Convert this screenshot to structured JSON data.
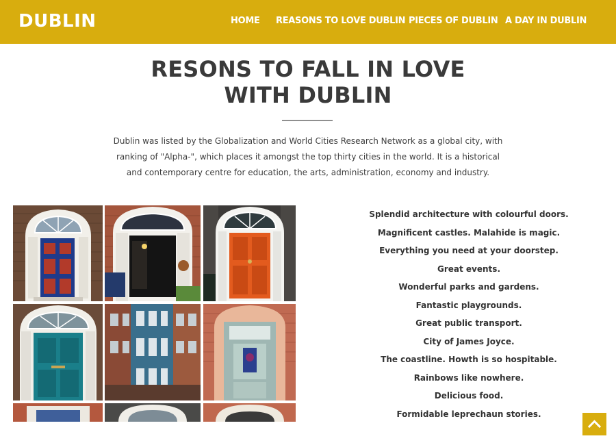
{
  "brand": "DUBLIN",
  "nav": {
    "home": "HOME",
    "reasons": "REASONS TO LOVE DUBLIN",
    "pieces": "PIECES OF DUBLIN",
    "day": "A DAY IN DUBLIN"
  },
  "main": {
    "title_line1": "RESONS TO FALL IN LOVE",
    "title_line2": "WITH DUBLIN",
    "intro_line1": "Dublin was listed by the Globalization and World Cities Research Network as a global city, with",
    "intro_line2": "ranking of \"Alpha-\", which places it amongst the top thirty cities in the world. It is a historical",
    "intro_line3": "and contemporary centre for education, the arts, administration, economy and industry."
  },
  "reasons": [
    "Splendid architecture with colourful doors.",
    "Magnificent castles. Malahide is magic.",
    "Everything you need at your doorstep.",
    "Great events.",
    "Wonderful parks and gardens.",
    "Fantastic playgrounds.",
    "Great public transport.",
    "City of James Joyce.",
    "The coastline. Howth is so hospitable.",
    "Rainbows like nowhere.",
    "Delicious food.",
    "Formidable leprechaun stories."
  ],
  "colors": {
    "accent": "#d8ad0e",
    "door_blue": "#1f3a8a",
    "door_orange": "#e35b1e",
    "door_teal": "#1a7f8a",
    "door_pale": "#b9cfc9"
  },
  "icons": {
    "back_to_top": "chevron-up-icon"
  }
}
